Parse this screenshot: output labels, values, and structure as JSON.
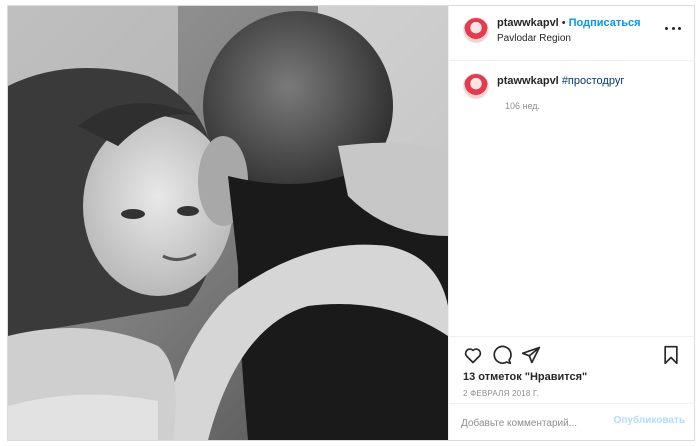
{
  "header": {
    "username": "ptawwkapvl",
    "separator": "•",
    "follow_label": "Подписаться",
    "location": "Pavlodar Region",
    "avatar_icon": "user-avatar-icon",
    "more_icon": "more-options-icon"
  },
  "caption": {
    "username": "ptawwkapvl",
    "hashtag": "#простодруг",
    "time_ago": "106 нед."
  },
  "actions": {
    "like_icon": "heart-icon",
    "comment_icon": "comment-icon",
    "share_icon": "share-icon",
    "save_icon": "bookmark-icon"
  },
  "likes_text": "13 отметок \"Нравится\"",
  "date": "2 ФЕВРАЛЯ 2018 Г.",
  "comment": {
    "placeholder": "Добавьте комментарий...",
    "post_label": "Опубликовать"
  },
  "colors": {
    "accent": "#0095f6",
    "hashtag": "#00376b",
    "muted": "#8e8e8e",
    "post_disabled": "#b3dbff"
  }
}
